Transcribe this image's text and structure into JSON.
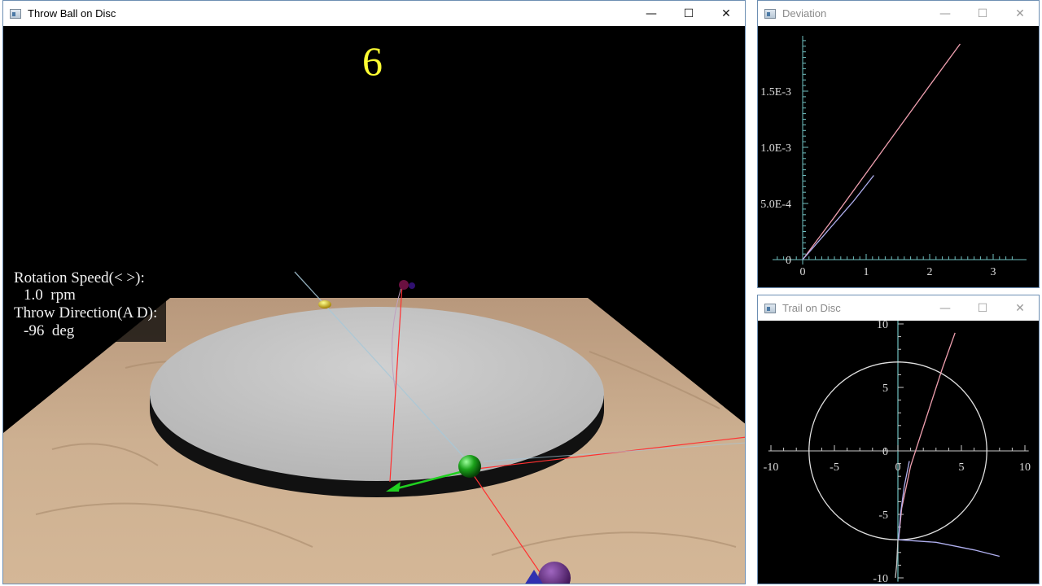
{
  "main_window": {
    "title": "Throw Ball on Disc",
    "counter": "6",
    "hud": {
      "rotation_label": "Rotation Speed(< >):",
      "rotation_value": "1.0  rpm",
      "direction_label": "Throw Direction(A D):",
      "direction_value": "-96  deg"
    }
  },
  "deviation_window": {
    "title": "Deviation",
    "chart_data": {
      "type": "line",
      "title": "",
      "xlabel": "",
      "ylabel": "",
      "xlim": [
        0,
        3.5
      ],
      "ylim": [
        0,
        0.002
      ],
      "x_ticks": [
        "0",
        "1",
        "2",
        "3"
      ],
      "y_ticks": [
        "0",
        "5.0E-4",
        "1.0E-3",
        "1.5E-3"
      ],
      "series": [
        {
          "x": [
            0,
            0.5,
            1.0,
            1.5,
            2.0,
            2.48
          ],
          "y": [
            0,
            0.00038,
            0.00077,
            0.00116,
            0.00155,
            0.00192
          ],
          "color": "#f0a0b0"
        },
        {
          "x": [
            0,
            0.4,
            0.8,
            1.12
          ],
          "y": [
            0,
            0.00026,
            0.00052,
            0.00075
          ],
          "color": "#b0b0f0"
        }
      ]
    }
  },
  "trail_window": {
    "title": "Trail on Disc",
    "chart_data": {
      "type": "line",
      "title": "",
      "xlabel": "",
      "ylabel": "",
      "xlim": [
        -10,
        10
      ],
      "ylim": [
        -10,
        10
      ],
      "x_ticks": [
        "-10",
        "-5",
        "0",
        "5",
        "10"
      ],
      "y_ticks": [
        "10",
        "5",
        "0",
        "-5",
        "-10"
      ],
      "circle_radius": 7,
      "series": [
        {
          "x": [
            0.05,
            0.3,
            1.0,
            2.2,
            3.5,
            4.5
          ],
          "y": [
            -7,
            -4.5,
            -1.2,
            2.5,
            6.5,
            9.3
          ],
          "color": "#f0a0b0"
        },
        {
          "x": [
            0.05,
            0.2,
            0.5,
            0.9
          ],
          "y": [
            -7,
            -5,
            -2.8,
            -0.8
          ],
          "color": "#b0b0f0"
        },
        {
          "x": [
            0.05,
            3.0,
            6.0,
            8.0
          ],
          "y": [
            -7,
            -7.2,
            -7.8,
            -8.3
          ],
          "color": "#b0b0f0"
        },
        {
          "x": [
            0.0,
            -0.05,
            -0.1,
            -0.2
          ],
          "y": [
            -7,
            -8.0,
            -9.0,
            -10.0
          ],
          "color": "#c8c8c8"
        }
      ]
    }
  }
}
